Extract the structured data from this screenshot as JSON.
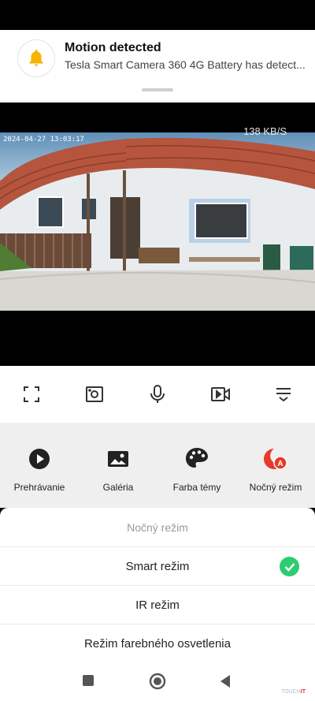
{
  "notification": {
    "title": "Motion detected",
    "body": "Tesla Smart Camera 360 4G Battery has detect...",
    "icon": "bell-icon",
    "accent": "#f5b300"
  },
  "camera": {
    "timestamp": "2024-04-27 13:03:17",
    "bitrate": "138 KB/S"
  },
  "controls": [
    {
      "icon": "fullscreen-icon"
    },
    {
      "icon": "screenshot-icon"
    },
    {
      "icon": "microphone-icon"
    },
    {
      "icon": "record-icon"
    },
    {
      "icon": "collapse-menu-icon"
    }
  ],
  "features": [
    {
      "label": "Prehrávanie",
      "icon": "play-icon"
    },
    {
      "label": "Galéria",
      "icon": "gallery-icon"
    },
    {
      "label": "Farba témy",
      "icon": "palette-icon"
    },
    {
      "label": "Nočný režim",
      "icon": "night-mode-icon",
      "color": "#e83a2a"
    }
  ],
  "sheet": {
    "title": "Nočný režim",
    "options": [
      {
        "label": "Smart režim",
        "selected": true
      },
      {
        "label": "IR režim",
        "selected": false
      },
      {
        "label": "Režim farebného osvetlenia",
        "selected": false
      }
    ],
    "check_color": "#2ecc71"
  },
  "navbar": [
    "square-icon",
    "home-circle-icon",
    "back-triangle-icon"
  ]
}
